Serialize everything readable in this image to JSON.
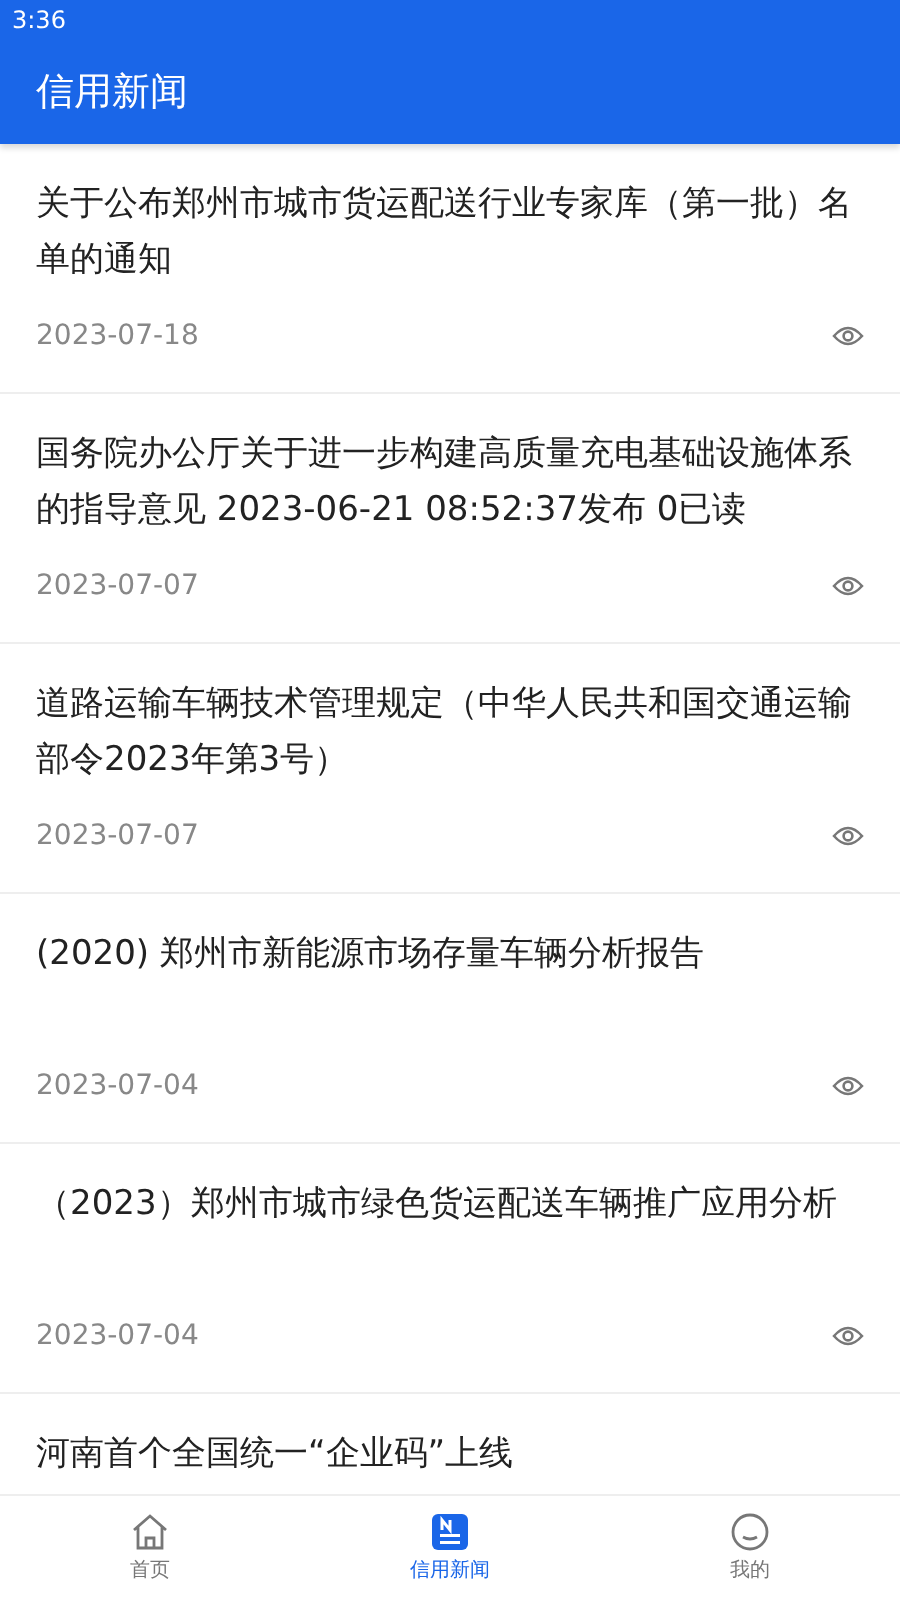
{
  "status_bar": {
    "time": "3:36"
  },
  "app_bar": {
    "title": "信用新闻"
  },
  "news": [
    {
      "title": "关于公布郑州市城市货运配送行业专家库（第一批）名单的通知",
      "date": "2023-07-18"
    },
    {
      "title": "国务院办公厅关于进一步构建高质量充电基础设施体系的指导意见 2023-06-21 08:52:37发布 0已读",
      "date": "2023-07-07"
    },
    {
      "title": "道路运输车辆技术管理规定（中华人民共和国交通运输部令2023年第3号）",
      "date": "2023-07-07"
    },
    {
      "title": "(2020) 郑州市新能源市场存量车辆分析报告",
      "date": "2023-07-04"
    },
    {
      "title": "（2023）郑州市城市绿色货运配送车辆推广应用分析",
      "date": "2023-07-04"
    },
    {
      "title": "河南首个全国统一“企业码”上线"
    }
  ],
  "tabs": [
    {
      "kind": "home",
      "label": "首页",
      "selected": false
    },
    {
      "kind": "news",
      "label": "信用新闻",
      "selected": true
    },
    {
      "kind": "profile",
      "label": "我的",
      "selected": false
    }
  ]
}
